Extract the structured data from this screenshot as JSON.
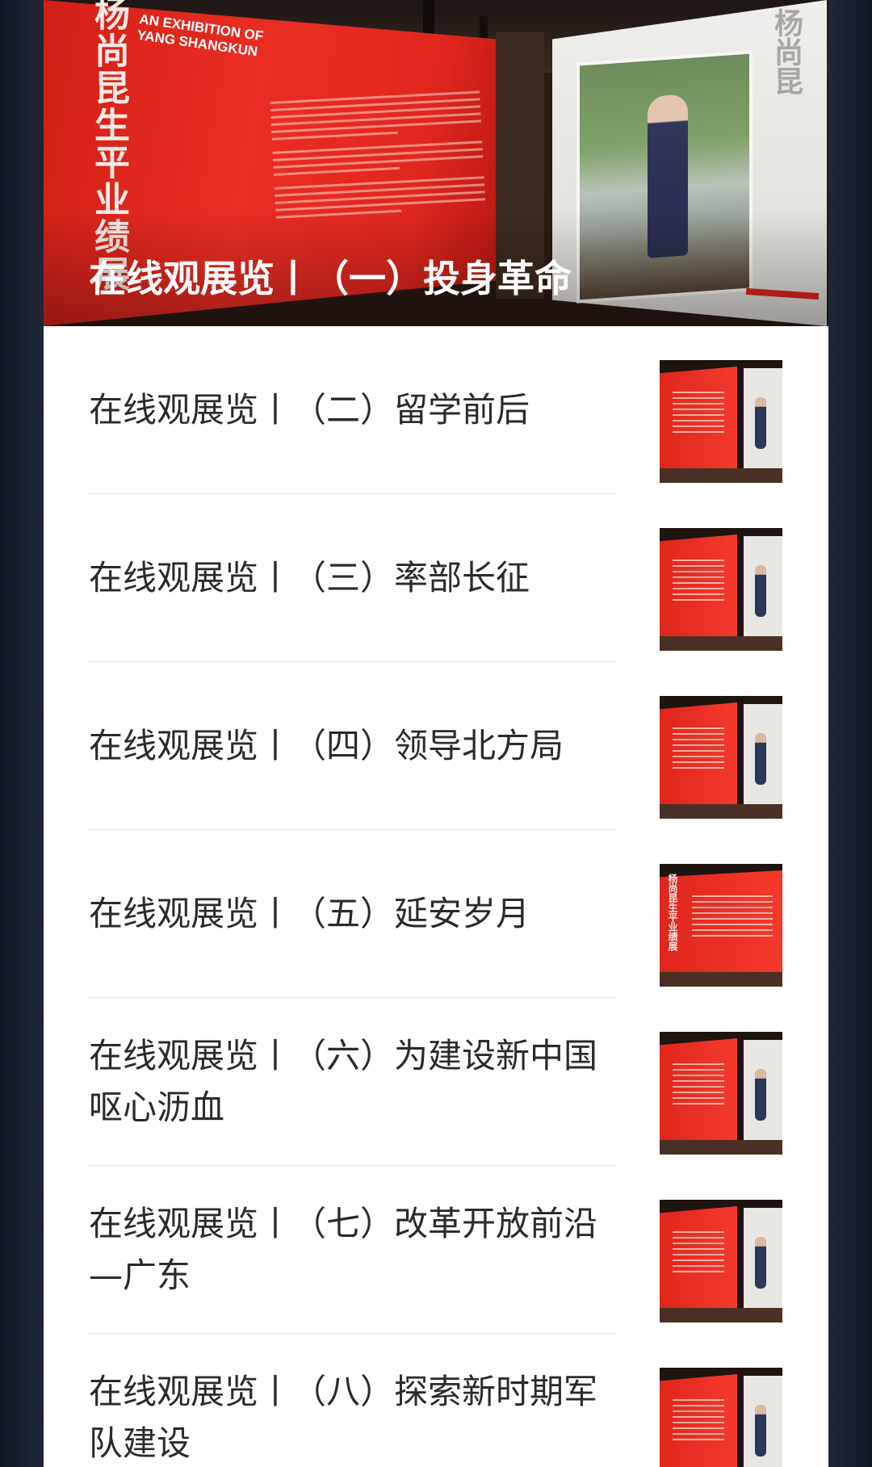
{
  "hero": {
    "title": "在线观展览丨（一）投身革命",
    "wall_title": "杨尚昆生平业绩展",
    "wall_subtitle": "AN EXHIBITION OF YANG SHANGKUN",
    "panel_title": "杨尚昆"
  },
  "thumb_text": "杨尚昆生平业绩展",
  "items": [
    {
      "title": "在线观展览丨（二）留学前后"
    },
    {
      "title": "在线观展览丨（三）率部长征"
    },
    {
      "title": "在线观展览丨（四）领导北方局"
    },
    {
      "title": "在线观展览丨（五）延安岁月"
    },
    {
      "title": "在线观展览丨（六）为建设新中国呕心沥血"
    },
    {
      "title": "在线观展览丨（七）改革开放前沿—广东"
    },
    {
      "title": "在线观展览丨（八）探索新时期军队建设"
    }
  ]
}
